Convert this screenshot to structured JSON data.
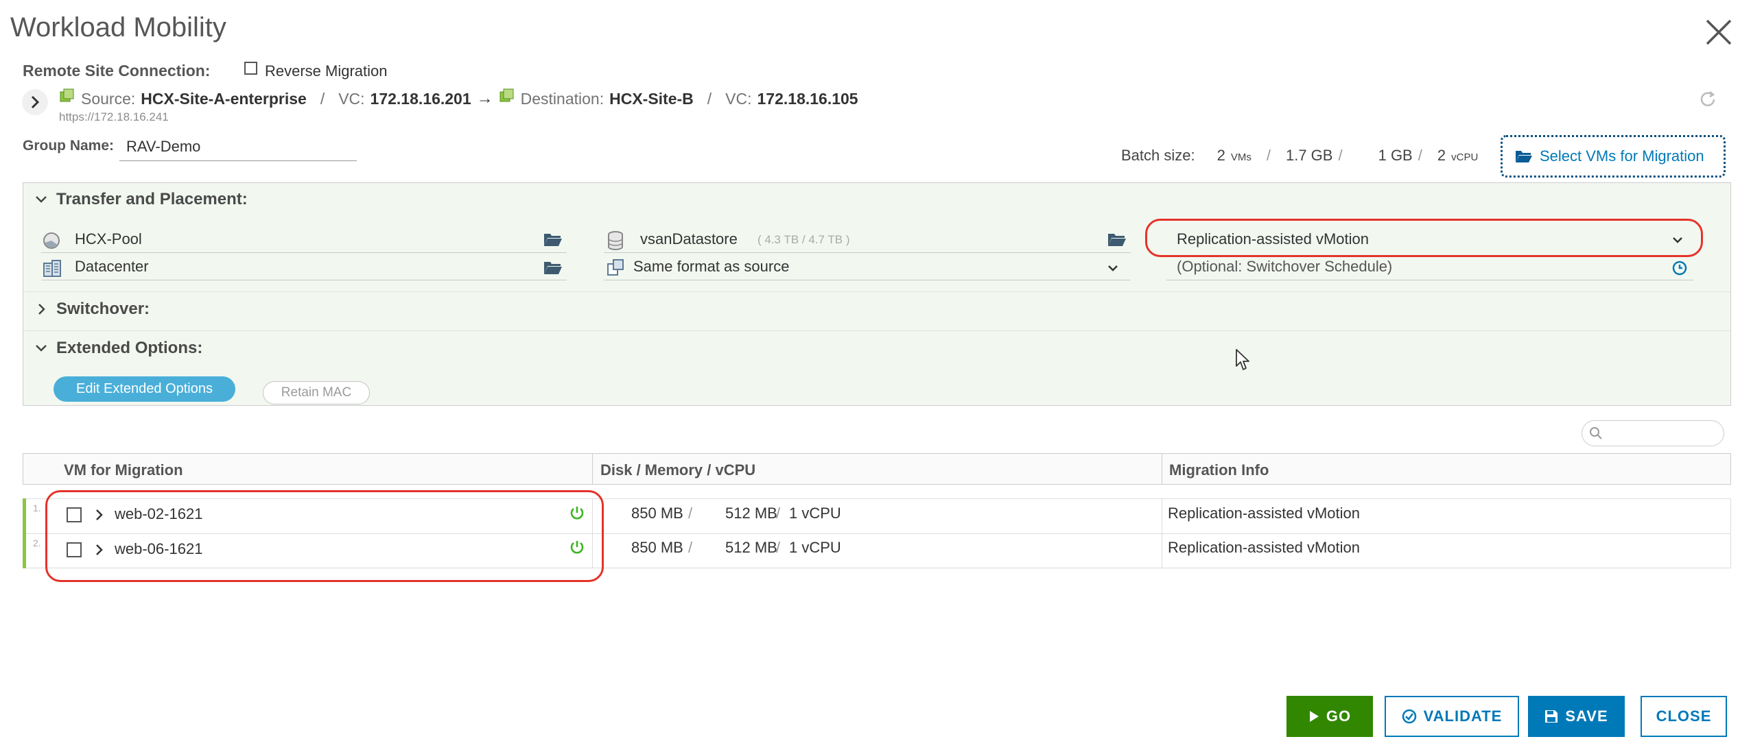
{
  "dialog": {
    "title": "Workload Mobility",
    "close_icon": "close-icon"
  },
  "connection": {
    "label": "Remote Site Connection:",
    "reverse_label": "Reverse Migration",
    "source_prefix": "Source:",
    "source_name": "HCX-Site-A-enterprise",
    "vc_label_1": "VC:",
    "vc_1": "172.18.16.201",
    "arrow": "→",
    "dest_prefix": "Destination:",
    "dest_name": "HCX-Site-B",
    "vc_label_2": "VC:",
    "vc_2": "172.18.16.105",
    "url": "https://172.18.16.241",
    "sep": "/"
  },
  "group": {
    "label": "Group Name:",
    "value": "RAV-Demo"
  },
  "batch": {
    "label": "Batch size:",
    "vms_num": "2",
    "vms_unit": "VMs",
    "disk": "1.7 GB",
    "mem": "1 GB",
    "vcpu_num": "2",
    "vcpu_unit": "vCPU",
    "sep": "/",
    "select_button": "Select VMs for Migration"
  },
  "transfer": {
    "title": "Transfer and Placement:",
    "pool": "HCX-Pool",
    "datacenter": "Datacenter",
    "datastore": "vsanDatastore",
    "datastore_size": "( 4.3 TB / 4.7 TB )",
    "format": "Same format as source",
    "migration_type": "Replication-assisted vMotion",
    "schedule_placeholder": "(Optional: Switchover Schedule)"
  },
  "switchover": {
    "title": "Switchover:"
  },
  "extended": {
    "title": "Extended Options:",
    "edit_button": "Edit Extended Options",
    "retain_mac": "Retain MAC"
  },
  "table": {
    "headers": [
      "VM for Migration",
      "Disk / Memory / vCPU",
      "Migration Info"
    ],
    "rows": [
      {
        "index": "1.",
        "name": "web-02-1621",
        "disk": "850 MB",
        "mem": "512 MB",
        "vcpu": "1 vCPU",
        "info": "Replication-assisted vMotion"
      },
      {
        "index": "2.",
        "name": "web-06-1621",
        "disk": "850 MB",
        "mem": "512 MB",
        "vcpu": "1 vCPU",
        "info": "Replication-assisted vMotion"
      }
    ],
    "sep": "/"
  },
  "footer": {
    "go": "GO",
    "validate": "VALIDATE",
    "save": "SAVE",
    "close": "CLOSE"
  },
  "colors": {
    "accent": "#0079b8",
    "go_green": "#318700",
    "highlight_red": "#e4332a",
    "panel_bg": "#f2f8f0",
    "row_marker": "#8cc63f"
  }
}
